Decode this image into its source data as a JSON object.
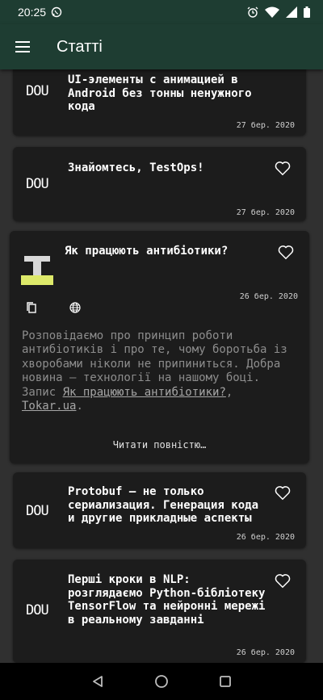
{
  "status": {
    "time": "20:25"
  },
  "appbar": {
    "title": "Статті"
  },
  "articles": [
    {
      "source": "DOU",
      "title": "UI-элементы с анимацией в Android без тонны ненужного кода",
      "date": "27 бер. 2020"
    },
    {
      "source": "DOU",
      "title": "Знайомтесь, TestOps!",
      "date": "27 бер. 2020"
    },
    {
      "source": "Tokar.ua",
      "title": "Як працюють антибіотики?",
      "date": "26 бер. 2020",
      "summary": "Розповідаємо про принцип роботи антибіотиків і про те, чому боротьба із хворобами ніколи не припиниться. Добра новина — технології на нашому боці. Запис ",
      "summary_link": "Як працюють антибіотики?",
      "summary_sep": ", ",
      "summary_source": "Tokar.ua",
      "summary_end": ".",
      "read_more": "Читати повністю…"
    },
    {
      "source": "DOU",
      "title": "Protobuf — не только сериализация. Генерация кода и другие прикладные аспекты",
      "date": "26 бер. 2020"
    },
    {
      "source": "DOU",
      "title": "Перші кроки в NLP: розглядаємо Python-бібліотеку TensorFlow та нейронні мережі в реальному завданні",
      "date": "26 бер. 2020"
    }
  ],
  "colors": {
    "appbar": "#1e3d32",
    "background": "#303030",
    "card": "#1c1c1c",
    "logo_accent": "#dde96a"
  }
}
